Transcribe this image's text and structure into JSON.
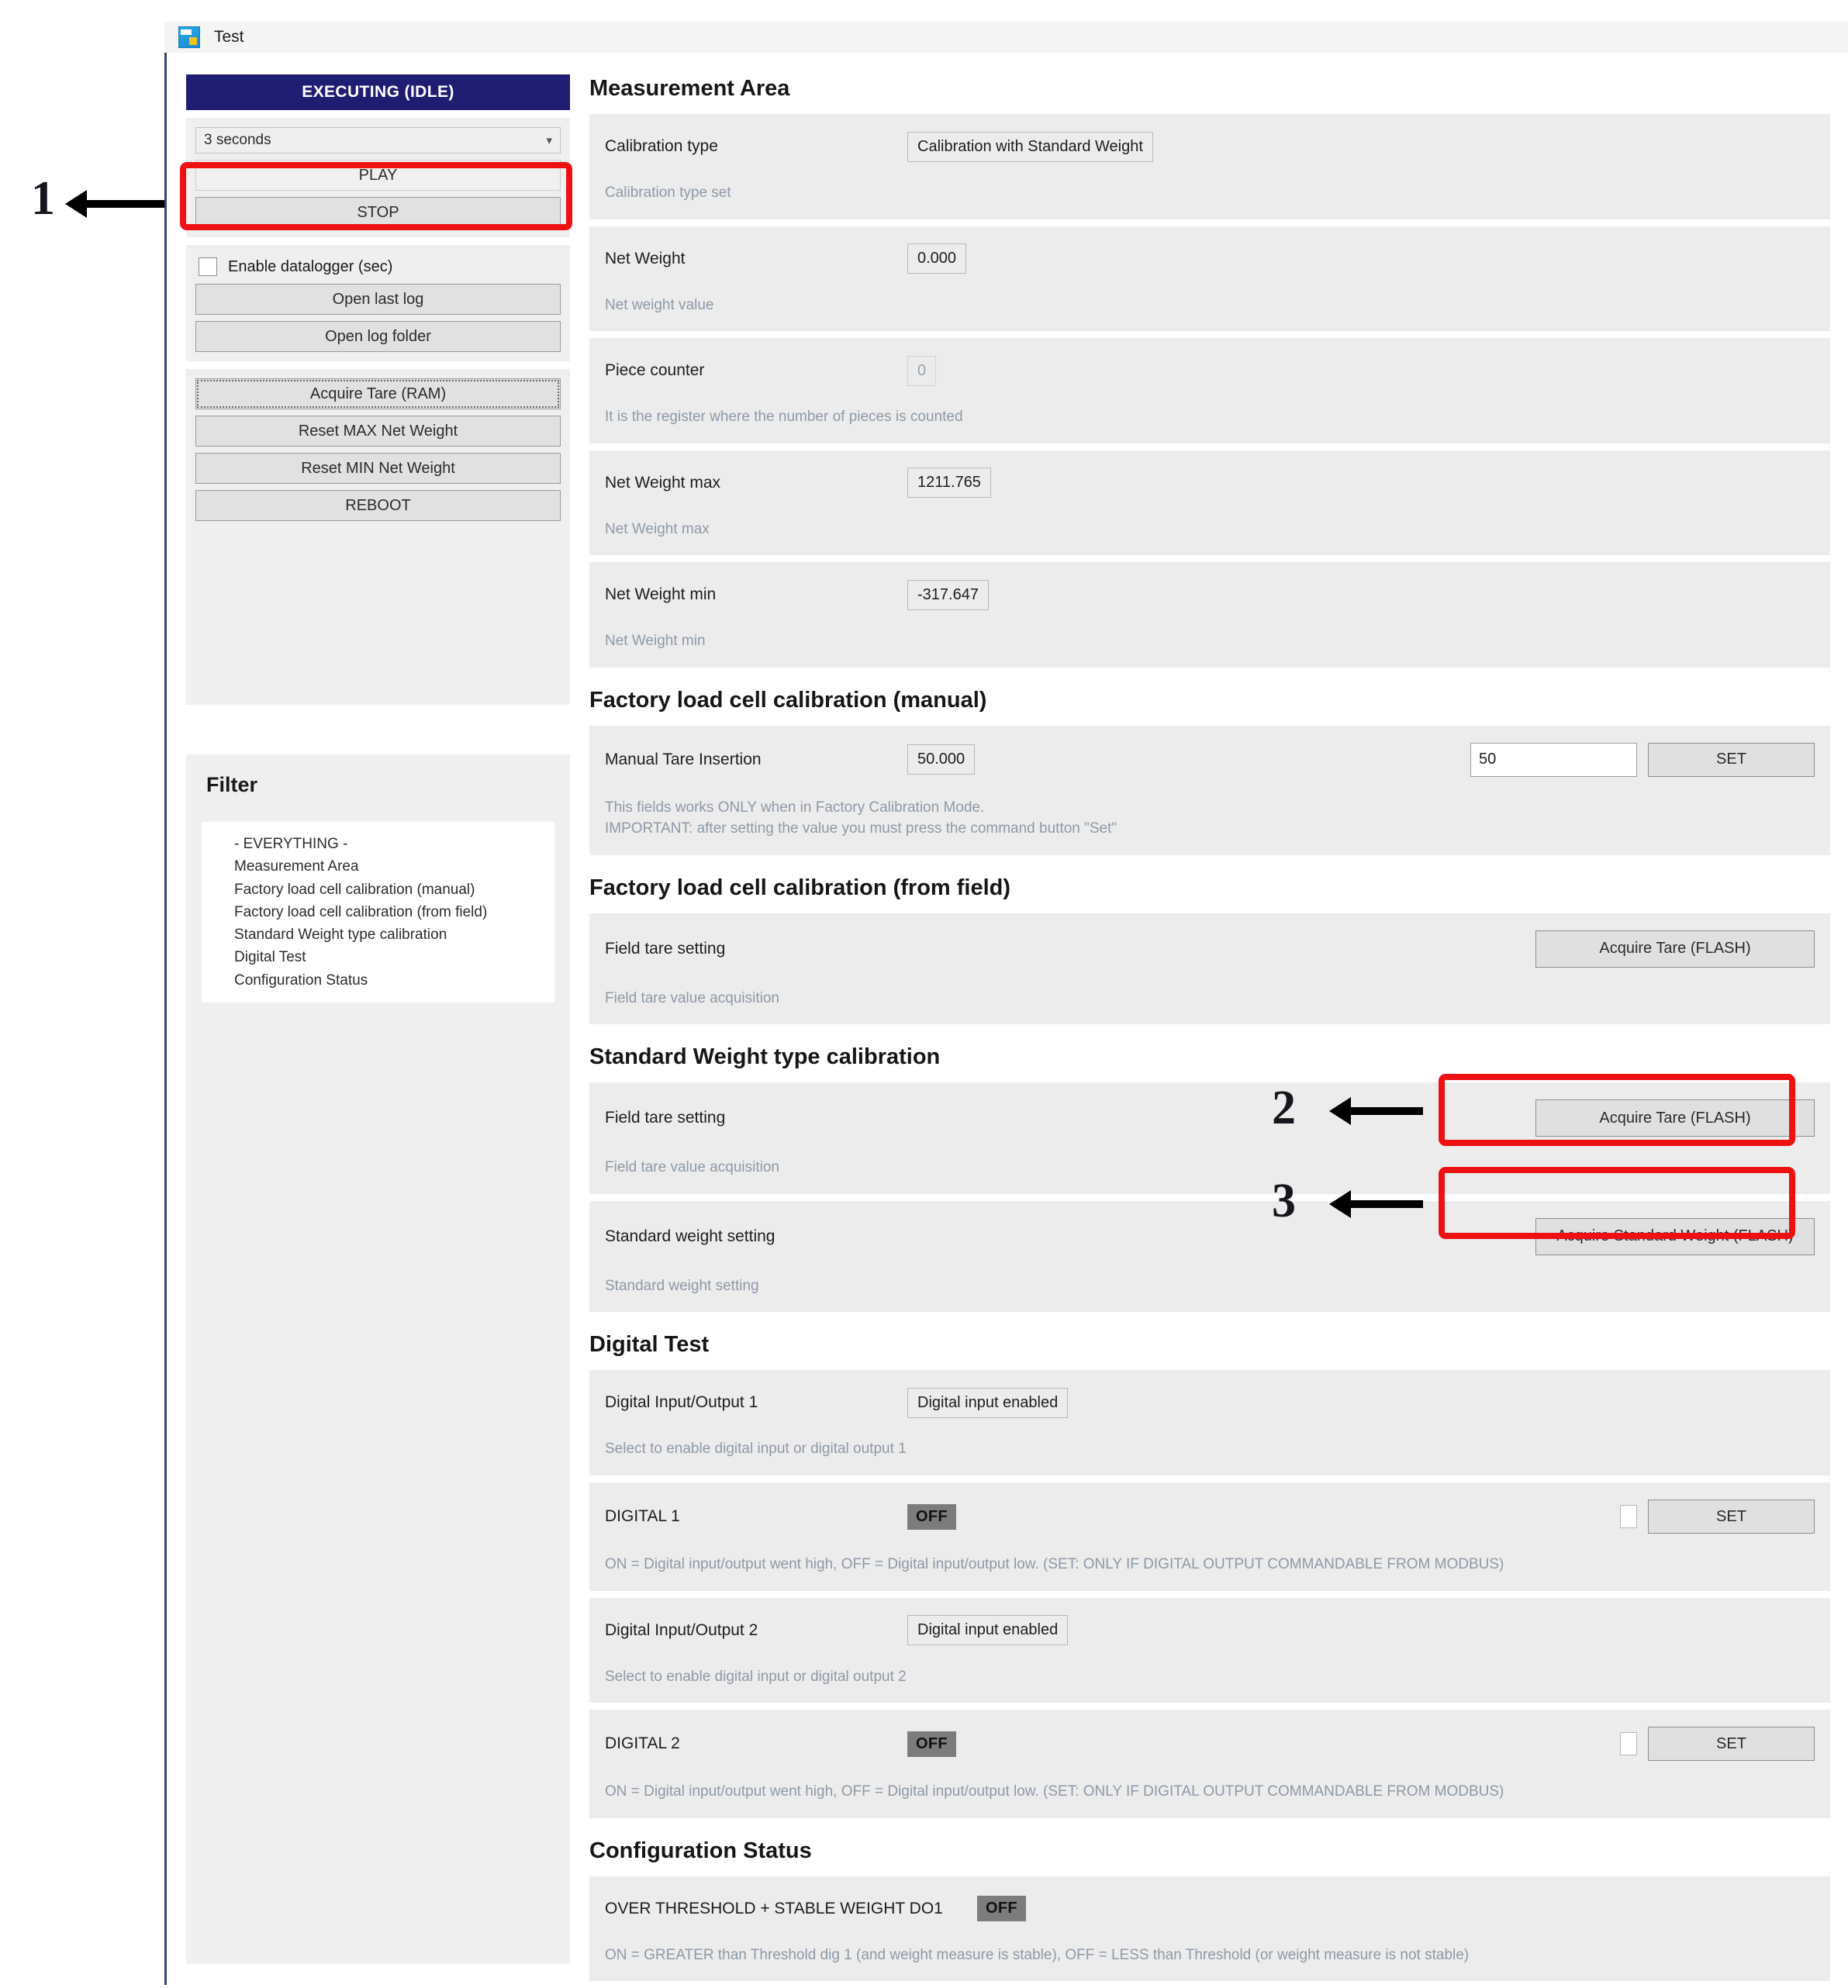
{
  "window": {
    "title": "Test",
    "icon": "app-icon"
  },
  "sidebar": {
    "status": "EXECUTING (IDLE)",
    "interval_select": {
      "value": "3 seconds",
      "chevron": "chevron-down-icon"
    },
    "play_label": "PLAY",
    "stop_label": "STOP",
    "datalogger_checkbox_label": "Enable datalogger (sec)",
    "open_last_log_label": "Open last log",
    "open_log_folder_label": "Open log folder",
    "acquire_tare_ram_label": "Acquire Tare (RAM)",
    "reset_max_label": "Reset MAX Net Weight",
    "reset_min_label": "Reset MIN Net Weight",
    "reboot_label": "REBOOT"
  },
  "filter": {
    "title": "Filter",
    "items": [
      "- EVERYTHING -",
      "Measurement Area",
      "Factory load cell calibration (manual)",
      "Factory load cell calibration (from field)",
      "Standard Weight type calibration",
      "Digital Test",
      "Configuration Status"
    ]
  },
  "sections": {
    "measurement_area": {
      "title": "Measurement Area",
      "rows": [
        {
          "label": "Calibration type",
          "value": "Calibration with Standard Weight",
          "desc": "Calibration type set"
        },
        {
          "label": "Net Weight",
          "value": "0.000",
          "desc": "Net weight value"
        },
        {
          "label": "Piece counter",
          "value": "0",
          "desc": "It is the register where the number of pieces is counted"
        },
        {
          "label": "Net Weight max",
          "value": "1211.765",
          "desc": "Net Weight max"
        },
        {
          "label": "Net Weight min",
          "value": "-317.647",
          "desc": "Net Weight min"
        }
      ]
    },
    "factory_manual": {
      "title": "Factory load cell calibration (manual)",
      "row": {
        "label": "Manual Tare Insertion",
        "value": "50.000",
        "input_value": "50",
        "set_label": "SET",
        "desc_line1": "This fields works ONLY when in Factory Calibration Mode.",
        "desc_line2": "IMPORTANT: after setting the value you must press the command button \"Set\""
      }
    },
    "factory_field": {
      "title": "Factory load cell calibration (from field)",
      "row": {
        "label": "Field tare setting",
        "button": "Acquire Tare (FLASH)",
        "desc": "Field tare value acquisition"
      }
    },
    "standard_weight": {
      "title": "Standard Weight type calibration",
      "rows": [
        {
          "label": "Field tare setting",
          "button": "Acquire Tare (FLASH)",
          "desc": "Field tare value acquisition"
        },
        {
          "label": "Standard weight setting",
          "button": "Acquire Standard Weight (FLASH)",
          "desc": "Standard weight setting"
        }
      ]
    },
    "digital_test": {
      "title": "Digital Test",
      "rows": [
        {
          "label": "Digital Input/Output 1",
          "value": "Digital input enabled",
          "desc": "Select to enable digital input or digital output 1"
        },
        {
          "label": "DIGITAL 1",
          "state": "OFF",
          "set_label": "SET",
          "desc": "ON = Digital input/output went high, OFF = Digital input/output low. (SET: ONLY IF DIGITAL OUTPUT COMMANDABLE FROM MODBUS)"
        },
        {
          "label": "Digital Input/Output 2",
          "value": "Digital input enabled",
          "desc": "Select to enable digital input or digital output 2"
        },
        {
          "label": "DIGITAL 2",
          "state": "OFF",
          "set_label": "SET",
          "desc": "ON = Digital input/output went high, OFF = Digital input/output low. (SET: ONLY IF DIGITAL OUTPUT COMMANDABLE FROM MODBUS)"
        }
      ]
    },
    "configuration_status": {
      "title": "Configuration Status",
      "rows": [
        {
          "label": "OVER THRESHOLD + STABLE WEIGHT DO1",
          "state": "OFF",
          "desc": "ON = GREATER than Threshold dig 1 (and weight measure is stable), OFF = LESS than Threshold (or weight measure is not stable)"
        }
      ]
    }
  },
  "annotations": {
    "accent_color": "#ee1111",
    "markers": [
      {
        "number": "1"
      },
      {
        "number": "2"
      },
      {
        "number": "3"
      }
    ]
  }
}
